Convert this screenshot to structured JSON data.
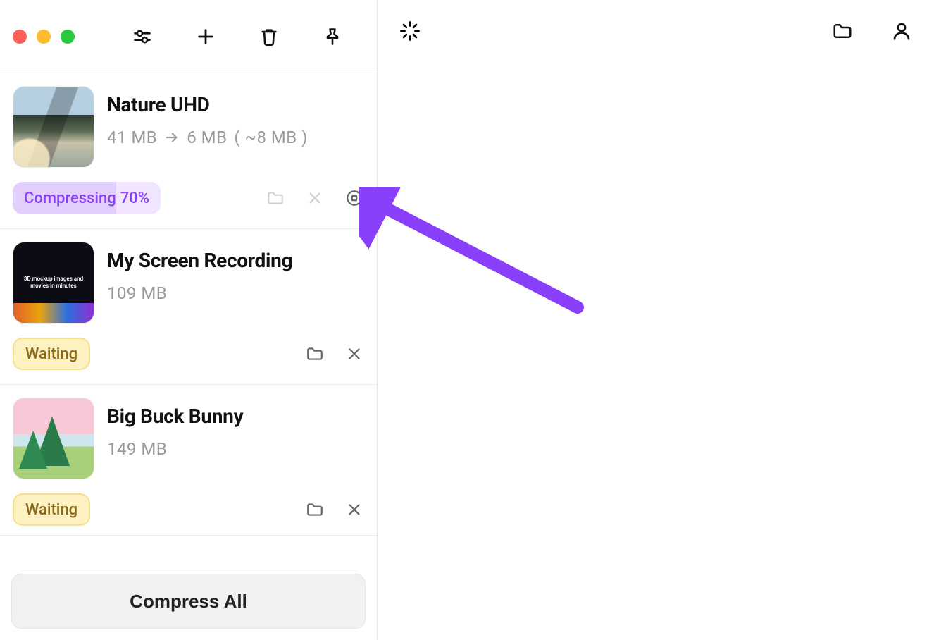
{
  "items": [
    {
      "title": "Nature UHD",
      "size_from": "41 MB",
      "size_to": "6 MB",
      "size_est": "( ~8 MB )",
      "status": {
        "type": "compressing",
        "label": "Compressing",
        "progress": "70%"
      },
      "thumb": "nature"
    },
    {
      "title": "My Screen Recording",
      "size_from": "109 MB",
      "status": {
        "type": "waiting",
        "label": "Waiting"
      },
      "thumb": "screenrec",
      "thumb_text": "3D mockup images and movies in minutes"
    },
    {
      "title": "Big Buck Bunny",
      "size_from": "149 MB",
      "status": {
        "type": "waiting",
        "label": "Waiting"
      },
      "thumb": "bunny"
    }
  ],
  "footer": {
    "compress_all": "Compress All"
  }
}
